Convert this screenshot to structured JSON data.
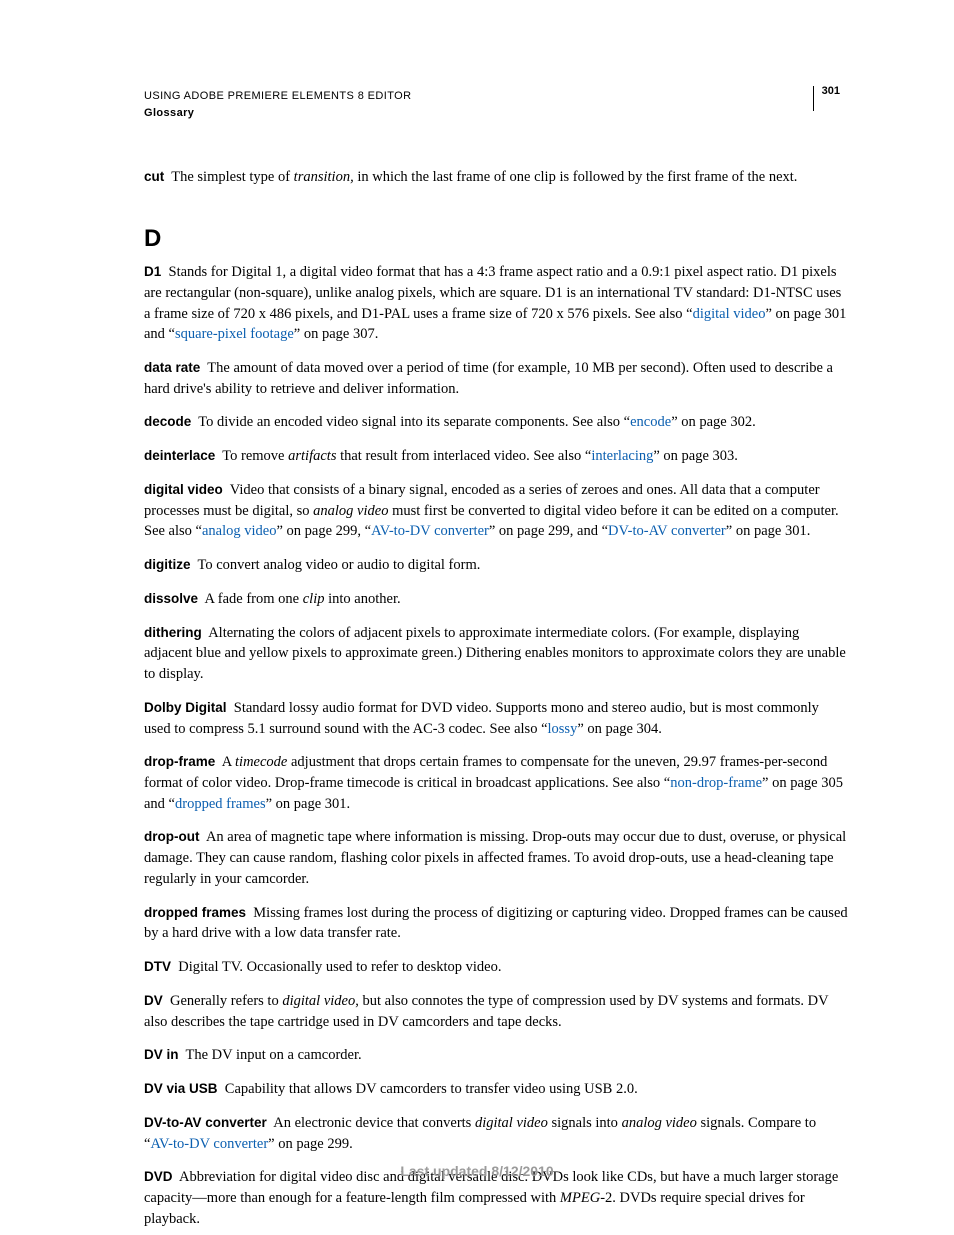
{
  "header": {
    "title": "USING ADOBE PREMIERE ELEMENTS 8 EDITOR",
    "section": "Glossary",
    "page_number": "301"
  },
  "section_letter": "D",
  "footer": "Last updated 8/12/2010",
  "entries": {
    "cut": {
      "term": "cut",
      "before_i": "The simplest type of ",
      "i": "transition,",
      "after_i": " in which the last frame of one clip is followed by the first frame of the next."
    },
    "d1": {
      "term": "D1",
      "part1": "Stands for Digital 1, a digital video format that has a 4:3 frame aspect ratio and a 0.9:1 pixel aspect ratio. D1 pixels are rectangular (non-square), unlike analog pixels, which are square. D1 is an international TV standard: D1-NTSC uses a frame size of 720 x 486 pixels, and D1-PAL uses a frame size of 720 x 576 pixels. See also “",
      "link1": "digital video",
      "mid1": "” on page 301 and “",
      "link2": "square-pixel footage",
      "part2": "” on page 307."
    },
    "data_rate": {
      "term": "data rate",
      "body": "The amount of data moved over a period of time (for example, 10 MB per second). Often used to describe a hard drive's ability to retrieve and deliver information."
    },
    "decode": {
      "term": "decode",
      "part1": "To divide an encoded video signal into its separate components. See also “",
      "link1": "encode",
      "part2": "” on page 302."
    },
    "deinterlace": {
      "term": "deinterlace",
      "before_i": "To remove ",
      "i": "artifacts",
      "mid": " that result from interlaced video. See also “",
      "link1": "interlacing",
      "part2": "” on page 303."
    },
    "digital_video": {
      "term": "digital video",
      "part1": "Video that consists of a binary signal, encoded as a series of zeroes and ones. All data that a computer processes must be digital, so ",
      "i": "analog video",
      "mid1": " must first be converted to digital video before it can be edited on a computer. See also “",
      "link1": "analog video",
      "mid2": "” on page 299, “",
      "link2": "AV-to-DV converter",
      "mid3": "” on page 299, and “",
      "link3": "DV-to-AV converter",
      "part2": "” on page 301."
    },
    "digitize": {
      "term": "digitize",
      "body": "To convert analog video or audio to digital form."
    },
    "dissolve": {
      "term": "dissolve",
      "before_i": "A fade from one ",
      "i": "clip",
      "after_i": " into another."
    },
    "dithering": {
      "term": "dithering",
      "body": "Alternating the colors of adjacent pixels to approximate intermediate colors. (For example, displaying adjacent blue and yellow pixels to approximate green.) Dithering enables monitors to approximate colors they are unable to display."
    },
    "dolby": {
      "term": "Dolby Digital",
      "part1": "Standard lossy audio format for DVD video. Supports mono and stereo audio, but is most commonly used to compress 5.1 surround sound with the AC-3 codec. See also “",
      "link1": "lossy",
      "part2": "” on page 304."
    },
    "drop_frame": {
      "term": "drop-frame",
      "before_i": "A ",
      "i": "timecode",
      "mid1": " adjustment that drops certain frames to compensate for the uneven, 29.97 frames-per-second format of color video. Drop-frame timecode is critical in broadcast applications. See also “",
      "link1": "non-drop-frame",
      "mid2": "” on page 305 and “",
      "link2": "dropped frames",
      "part2": "” on page 301."
    },
    "drop_out": {
      "term": "drop-out",
      "body": "An area of magnetic tape where information is missing. Drop-outs may occur due to dust, overuse, or physical damage. They can cause random, flashing color pixels in affected frames. To avoid drop-outs, use a head-cleaning tape regularly in your camcorder."
    },
    "dropped_frames": {
      "term": "dropped frames",
      "body": "Missing frames lost during the process of digitizing or capturing video. Dropped frames can be caused by a hard drive with a low data transfer rate."
    },
    "dtv": {
      "term": "DTV",
      "body": "Digital TV. Occasionally used to refer to desktop video."
    },
    "dv": {
      "term": "DV",
      "before_i": "Generally refers to ",
      "i": "digital video",
      "after_i": ", but also connotes the type of compression used by DV systems and formats. DV also describes the tape cartridge used in DV camcorders and tape decks."
    },
    "dv_in": {
      "term": "DV in",
      "body": "The DV input on a camcorder."
    },
    "dv_usb": {
      "term": "DV via USB",
      "body": "Capability that allows DV camcorders to transfer video using USB 2.0."
    },
    "dv_to_av": {
      "term": "DV-to-AV converter",
      "before_i1": "An electronic device that converts ",
      "i1": "digital video",
      "mid1": " signals into ",
      "i2": "analog video",
      "mid2": " signals. Compare to “",
      "link1": "AV-to-DV converter",
      "part2": "” on page 299."
    },
    "dvd": {
      "term": "DVD",
      "part1": "Abbreviation for digital video disc and digital versatile disc. DVDs look like CDs, but have a much larger storage capacity—more than enough for a feature-length film compressed with ",
      "i": "MPEG",
      "part2": "-2. DVDs require special drives for playback."
    }
  }
}
